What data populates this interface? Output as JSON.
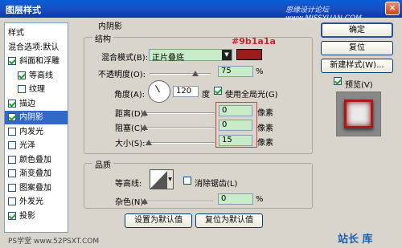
{
  "window": {
    "title": "图层样式",
    "watermark": "思缘设计论坛 www.MISSYUAN.COM",
    "close_glyph": "×"
  },
  "sidebar": {
    "items": [
      {
        "label": "样式",
        "checkbox": false,
        "checked": false,
        "selected": false
      },
      {
        "label": "混合选项:默认",
        "checkbox": false,
        "checked": false,
        "selected": false
      },
      {
        "label": "斜面和浮雕",
        "checkbox": true,
        "checked": true,
        "selected": false
      },
      {
        "label": "等高线",
        "checkbox": true,
        "checked": true,
        "selected": false,
        "indent": true
      },
      {
        "label": "纹理",
        "checkbox": true,
        "checked": false,
        "selected": false,
        "indent": true
      },
      {
        "label": "描边",
        "checkbox": true,
        "checked": true,
        "selected": false
      },
      {
        "label": "内阴影",
        "checkbox": true,
        "checked": true,
        "selected": true
      },
      {
        "label": "内发光",
        "checkbox": true,
        "checked": false,
        "selected": false
      },
      {
        "label": "光泽",
        "checkbox": true,
        "checked": false,
        "selected": false
      },
      {
        "label": "颜色叠加",
        "checkbox": true,
        "checked": false,
        "selected": false
      },
      {
        "label": "渐变叠加",
        "checkbox": true,
        "checked": false,
        "selected": false
      },
      {
        "label": "图案叠加",
        "checkbox": true,
        "checked": false,
        "selected": false
      },
      {
        "label": "外发光",
        "checkbox": true,
        "checked": false,
        "selected": false
      },
      {
        "label": "投影",
        "checkbox": true,
        "checked": true,
        "selected": false
      }
    ]
  },
  "inner_shadow": {
    "section_title": "内阴影",
    "structure_title": "结构",
    "blend_mode_label": "混合模式(B):",
    "blend_mode_value": "正片叠底",
    "color_annotation": "#9b1a1a",
    "shadow_color": "#9b1a1a",
    "opacity_label": "不透明度(O):",
    "opacity_value": "75",
    "opacity_fraction": 0.75,
    "percent_unit": "%",
    "angle_label": "角度(A):",
    "angle_value": "120",
    "degree_unit": "度",
    "global_light_label": "使用全局光(G)",
    "global_light_checked": true,
    "distance_label": "距离(D):",
    "distance_value": "0",
    "distance_fraction": 0,
    "choke_label": "阻塞(C):",
    "choke_value": "0",
    "choke_fraction": 0,
    "size_label": "大小(S):",
    "size_value": "15",
    "size_fraction": 0.06,
    "pixel_unit": "像素",
    "quality_title": "品质",
    "contour_label": "等高线:",
    "antialias_label": "消除锯齿(L)",
    "antialias_checked": false,
    "noise_label": "杂色(N):",
    "noise_value": "0",
    "noise_fraction": 0,
    "set_default_button": "设置为默认值",
    "reset_default_button": "复位为默认值"
  },
  "right": {
    "ok": "确定",
    "reset": "复位",
    "new_style": "新建样式(W)...",
    "preview_label": "预览(V)",
    "preview_checked": true
  },
  "footer": {
    "watermark_left": "PS学堂 www.52PSXT.COM",
    "watermark_right": "站长 库"
  }
}
